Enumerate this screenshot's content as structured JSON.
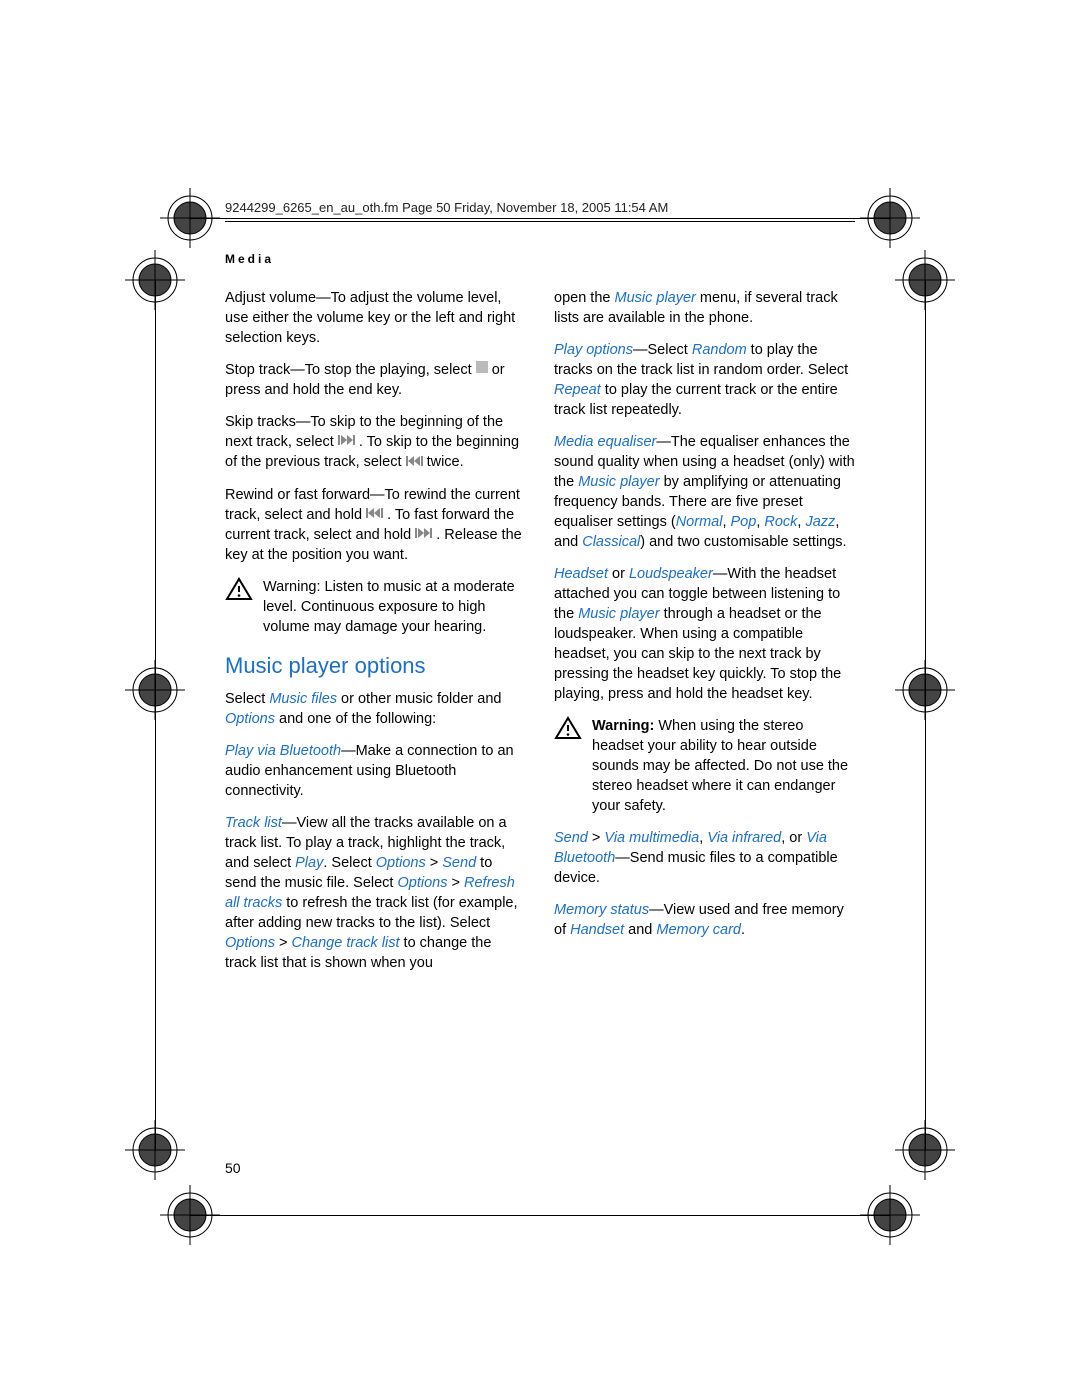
{
  "crop_header": "9244299_6265_en_au_oth.fm  Page 50  Friday, November 18, 2005  11:54 AM",
  "section_header": "Media",
  "page_number": "50",
  "subhead": "Music player options",
  "col": {
    "p1a": "Adjust volume—To adjust the volume level, use either the volume key or the left and right selection keys.",
    "p2a": "Stop track—To stop the playing, select ",
    "p2b": " or press and hold the end key.",
    "p3a": "Skip tracks—To skip to the beginning of the next track, select ",
    "p3b": " . To skip to the beginning of the previous track, select ",
    "p3c": " twice.",
    "p4a": "Rewind or fast forward—To rewind the current track, select and hold ",
    "p4b": " . To fast forward the current track, select and hold ",
    "p4c": " . Release the key at the position you want.",
    "w1": "Warning: Listen to music at a moderate level. Continuous exposure to high volume may damage your hearing.",
    "p5a": "Select ",
    "p5_musicfiles": "Music files",
    "p5b": " or other music folder and ",
    "p5_options": "Options",
    "p5c": " and one of the following:",
    "p6_pvb": "Play via Bluetooth",
    "p6a": "—Make a connection to an audio enhancement using Bluetooth connectivity.",
    "p7_tl": "Track list",
    "p7a": "—View all the tracks available on a track list. To play a track, highlight the track, and select ",
    "p7_play": "Play",
    "p7b": ". Select ",
    "p7_opt": "Options",
    "p7_gt1": " > ",
    "p7_send": "Send",
    "p7c": " to send the music file. Select ",
    "p7_opt2": "Options",
    "p7_gt2": " > ",
    "p7_refresh": "Refresh all tracks",
    "p7d": " to refresh the track list (for example, after adding new tracks to the list). Select ",
    "p7_opt3": "Options",
    "p7_gt3": " > ",
    "p7_ctl": "Change track list",
    "p7e": " to change the track list that is shown when you",
    "p8a": "open the ",
    "p8_mp": "Music player",
    "p8b": " menu, if several track lists are available in the phone.",
    "p9_po": "Play options",
    "p9a": "—Select ",
    "p9_random": "Random",
    "p9b": " to play the tracks on the track list in random order. Select ",
    "p9_repeat": "Repeat",
    "p9c": " to play the current track or the entire track list repeatedly.",
    "p10_me": "Media equaliser",
    "p10a": "—The equaliser enhances the sound quality when using a headset (only) with the ",
    "p10_mp": "Music player",
    "p10b": " by amplifying or attenuating frequency bands. There are five preset equaliser settings (",
    "p10_normal": "Normal",
    "p10_c1": ", ",
    "p10_pop": "Pop",
    "p10_c2": ", ",
    "p10_rock": "Rock",
    "p10_c3": ", ",
    "p10_jazz": "Jazz",
    "p10_c4": ", and ",
    "p10_classical": "Classical",
    "p10c": ") and two customisable settings.",
    "p11_hs": "Headset",
    "p11_or": " or ",
    "p11_ls": "Loudspeaker",
    "p11a": "—With the headset attached you can toggle between listening to the ",
    "p11_mp": "Music player",
    "p11b": " through a headset or the loudspeaker. When using a compatible headset, you can skip to the next track by pressing the headset key quickly. To stop the playing, press and hold the headset key.",
    "w2a": "Warning:",
    "w2b": " When using the stereo headset your ability to hear outside sounds may be affected. Do not use the stereo headset where it can endanger your safety.",
    "p12_send": "Send",
    "p12_gt": " > ",
    "p12_vm": "Via multimedia",
    "p12_c1": ", ",
    "p12_vi": "Via infrared",
    "p12a": ", or ",
    "p12_vb": "Via Bluetooth",
    "p12b": "—Send music files to a compatible device.",
    "p13_ms": "Memory status",
    "p13a": "—View used and free memory of ",
    "p13_hs": "Handset",
    "p13_and": " and ",
    "p13_mc": "Memory card",
    "p13b": "."
  }
}
